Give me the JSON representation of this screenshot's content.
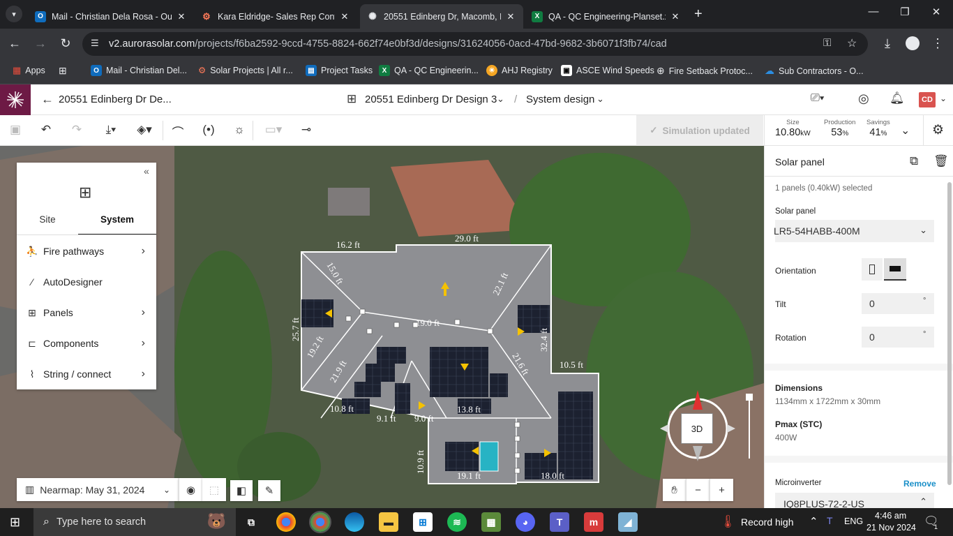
{
  "browser": {
    "tabs": [
      {
        "title": "Mail - Christian Dela Rosa - Out",
        "favicon": "outlook",
        "color": "#0f6cbd",
        "glyph": "O"
      },
      {
        "title": "Kara Eldridge- Sales Rep Conta",
        "favicon": "hubspot",
        "color": "#ff7a59",
        "glyph": "ᗯ"
      },
      {
        "title": "20551 Edinberg Dr, Macomb, M",
        "favicon": "aurora",
        "color": "#202124",
        "glyph": "✺"
      },
      {
        "title": "QA - QC Engineering-Planset.xl",
        "favicon": "excel",
        "color": "#107c41",
        "glyph": "X"
      }
    ],
    "tab_dropdown_icon": "chevron-down-icon",
    "new_tab_icon": "+",
    "url_host": "v2.aurorasolar.com",
    "url_path": "/projects/f6ba2592-9ccd-4755-8824-662f74e0bf3d/designs/31624056-0acd-47bd-9682-3b6071f3fb74/cad",
    "bookmarks": [
      {
        "label": "Apps",
        "icon": "apps-grid-icon"
      },
      {
        "label": "Mail - Christian Del...",
        "icon": "outlook-icon"
      },
      {
        "label": "Solar Projects | All r...",
        "icon": "hubspot-icon"
      },
      {
        "label": "Project Tasks",
        "icon": "doc-icon"
      },
      {
        "label": "QA - QC Engineerin...",
        "icon": "excel-icon"
      },
      {
        "label": "AHJ Registry",
        "icon": "sun-icon"
      },
      {
        "label": "ASCE Wind Speeds",
        "icon": "asce-icon"
      },
      {
        "label": "Fire Setback Protoc...",
        "icon": "globe-icon"
      },
      {
        "label": "Sub Contractors - O...",
        "icon": "cloud-icon"
      }
    ]
  },
  "app": {
    "project_title": "20551 Edinberg Dr De...",
    "design_name": "20551 Edinberg Dr Design 3",
    "breadcrumb_sep": "/",
    "mode": "System design",
    "avatar_initials": "CD",
    "simulation_status": "Simulation updated",
    "stats": {
      "size_label": "Size",
      "size_value": "10.80",
      "size_unit": "kW",
      "production_label": "Production",
      "production_value": "53",
      "production_unit": "%",
      "savings_label": "Savings",
      "savings_value": "41",
      "savings_unit": "%"
    }
  },
  "left_panel": {
    "tabs": [
      "Site",
      "System"
    ],
    "active_tab": "System",
    "items": [
      {
        "label": "Fire pathways",
        "icon": "fire-pathways-icon",
        "has_submenu": true
      },
      {
        "label": "AutoDesigner",
        "icon": "magic-wand-icon",
        "has_submenu": false
      },
      {
        "label": "Panels",
        "icon": "panels-grid-icon",
        "has_submenu": true
      },
      {
        "label": "Components",
        "icon": "component-icon",
        "has_submenu": true
      },
      {
        "label": "String / connect",
        "icon": "string-icon",
        "has_submenu": true
      }
    ]
  },
  "map": {
    "imagery_label": "Nearmap: May 31, 2024",
    "view_3d_label": "3D",
    "dimensions": [
      "16.2 ft",
      "29.0 ft",
      "15.0 ft",
      "22.1 ft",
      "25.7 ft",
      "19.0 ft",
      "32.4 ft",
      "19.2 ft",
      "21.9 ft",
      "21.6 ft",
      "10.5 ft",
      "10.8 ft",
      "9.1 ft",
      "9.0 ft",
      "13.8 ft",
      "10.9 ft",
      "19.1 ft",
      "18.0 ft"
    ]
  },
  "right_panel": {
    "title": "Solar panel",
    "selection_info": "1 panels (0.40kW) selected",
    "panel_label": "Solar panel",
    "panel_model": "LR5-54HABB-400M",
    "orientation_label": "Orientation",
    "tilt_label": "Tilt",
    "tilt_value": "0",
    "rotation_label": "Rotation",
    "rotation_value": "0",
    "degree_unit": "°",
    "dimensions_label": "Dimensions",
    "dimensions_value": "1134mm x 1722mm x 30mm",
    "pmax_label": "Pmax (STC)",
    "pmax_value": "400W",
    "microinverter_label": "Microinverter",
    "remove_label": "Remove",
    "microinverter_model": "IQ8PLUS-72-2-US",
    "accent_color": "#1a8fc8"
  },
  "taskbar": {
    "search_placeholder": "Type here to search",
    "weather_text": "Record high",
    "language": "ENG",
    "time": "4:46 am",
    "date": "21 Nov 2024",
    "notification_count": "1"
  }
}
